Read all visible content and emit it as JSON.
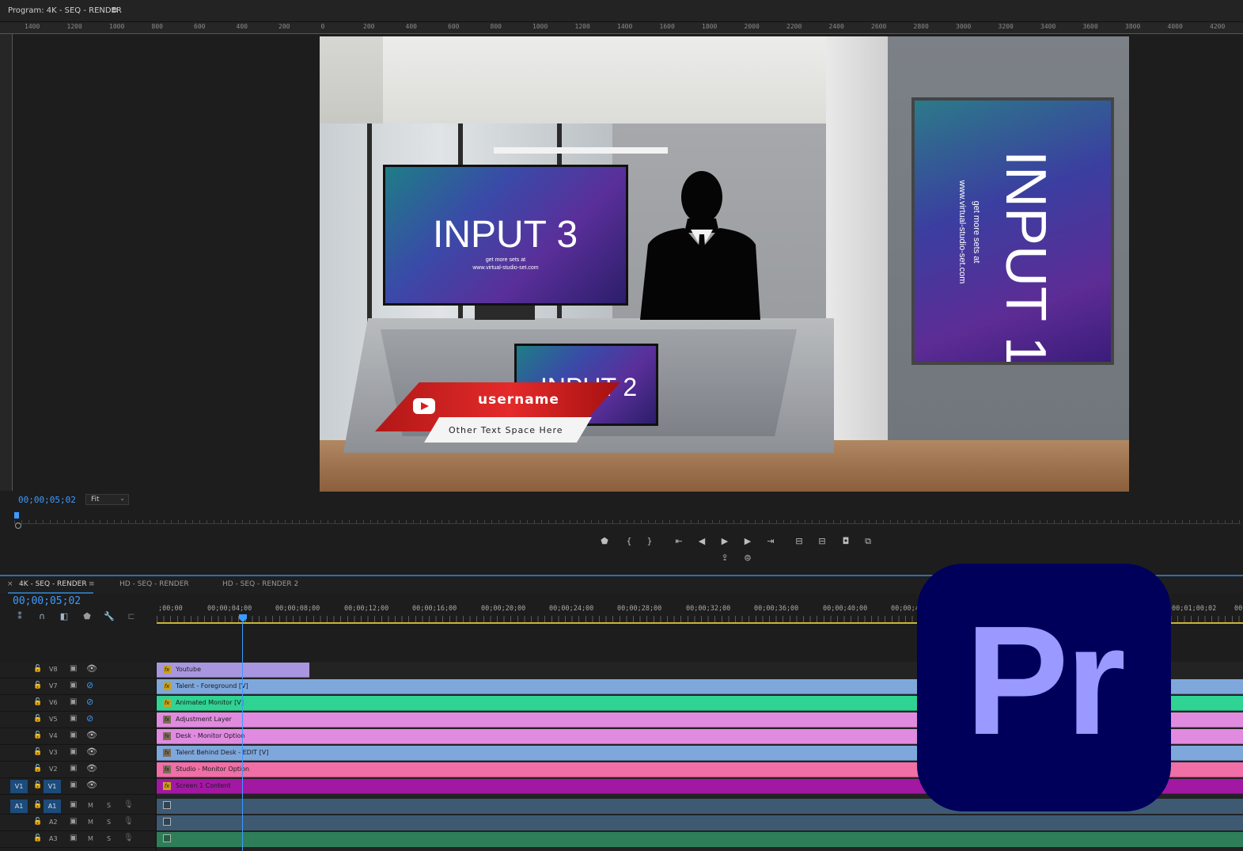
{
  "program_monitor": {
    "title": "Program: 4K - SEQ - RENDER",
    "menu_glyph": "≡",
    "ruler_labels": [
      "1400",
      "1200",
      "1000",
      "800",
      "600",
      "400",
      "200",
      "0",
      "200",
      "400",
      "600",
      "800",
      "1000",
      "1200",
      "1400",
      "1600",
      "1800",
      "2000",
      "2200",
      "2400",
      "2600",
      "2800",
      "3000",
      "3200",
      "3400",
      "3600",
      "3800",
      "4000",
      "4200"
    ],
    "timecode": "00;00;05;02",
    "zoom": "Fit",
    "frame": {
      "monitor_3_label": "INPUT 3",
      "monitor_3_sub_line1": "get more sets at",
      "monitor_3_sub_line2": "www.virtual-studio-set.com",
      "monitor_2_label": "INPUT 2",
      "poster_1_label": "INPUT 1",
      "poster_1_sub_line1": "get more sets at",
      "poster_1_sub_line2": "www.virtual-studio-set.com",
      "lower_third_username": "username",
      "lower_third_text": "Other Text Space Here"
    },
    "controls": [
      {
        "name": "add-marker-button",
        "glyph": "⬟"
      },
      {
        "name": "mark-in-button",
        "glyph": "{"
      },
      {
        "name": "mark-out-button",
        "glyph": "}"
      },
      {
        "name": "go-to-in-button",
        "glyph": "⇤"
      },
      {
        "name": "step-back-button",
        "glyph": "◀"
      },
      {
        "name": "play-button",
        "glyph": "▶"
      },
      {
        "name": "step-forward-button",
        "glyph": "▶"
      },
      {
        "name": "go-to-out-button",
        "glyph": "⇥"
      },
      {
        "name": "lift-button",
        "glyph": "⊟"
      },
      {
        "name": "extract-button",
        "glyph": "⊟"
      },
      {
        "name": "export-frame-button",
        "glyph": "◘"
      },
      {
        "name": "compare-button",
        "glyph": "⧉"
      }
    ],
    "controls_row2": [
      {
        "name": "export-button",
        "glyph": "⇪"
      },
      {
        "name": "vr-button",
        "glyph": "⊜"
      }
    ]
  },
  "timeline": {
    "tabs": [
      {
        "label": "4K - SEQ - RENDER",
        "active": true
      },
      {
        "label": "HD - SEQ - RENDER",
        "active": false
      },
      {
        "label": "HD - SEQ - RENDER 2",
        "active": false
      }
    ],
    "tab_close_glyph": "×",
    "tab_menu_glyph": "≡",
    "timecode": "00;00;05;02",
    "ruler_labels": [
      ";00;00",
      "00;00;04;00",
      "00;00;08;00",
      "00;00;12;00",
      "00;00;16;00",
      "00;00;20;00",
      "00;00;24;00",
      "00;00;28;00",
      "00;00;32;00",
      "00;00;36;00",
      "00;00;40;00",
      "00;00;44",
      "00;01;00;02",
      "00"
    ],
    "tools": [
      "⁑",
      "∩",
      "◧",
      "⬟",
      "🔧",
      "⊏"
    ],
    "video_tracks": [
      {
        "name": "V8",
        "eye_visible": true
      },
      {
        "name": "V7",
        "eye_visible": false
      },
      {
        "name": "V6",
        "eye_visible": false
      },
      {
        "name": "V5",
        "eye_visible": false
      },
      {
        "name": "V4",
        "eye_visible": true
      },
      {
        "name": "V3",
        "eye_visible": true
      },
      {
        "name": "V2",
        "eye_visible": true
      },
      {
        "name": "V1",
        "eye_visible": true,
        "source_target": "V1"
      }
    ],
    "audio_tracks": [
      {
        "name": "A1",
        "source_target": "A1"
      },
      {
        "name": "A2"
      },
      {
        "name": "A3"
      }
    ],
    "track_glyphs": {
      "lock": "🔓",
      "film": "▣",
      "eye": "👁",
      "eye_off": "⊘",
      "mute": "M",
      "solo": "S",
      "mic": "🎙"
    },
    "clips": [
      {
        "track": "V8",
        "label": "Youtube",
        "color": "#a897e0",
        "full": false
      },
      {
        "track": "V7",
        "label": "Talent - Foreground [V]",
        "color": "#7ea7dc",
        "full": true
      },
      {
        "track": "V6",
        "label": "Animated Monitor [V]",
        "color": "#2fd393",
        "full": true
      },
      {
        "track": "V5",
        "label": "Adjustment Layer",
        "color": "#e08be0",
        "full": true
      },
      {
        "track": "V4",
        "label": "Desk - Monitor Option",
        "color": "#e08be0",
        "full": true
      },
      {
        "track": "V3",
        "label": "Talent Behind Desk - EDIT [V]",
        "color": "#7ea7dc",
        "full": true
      },
      {
        "track": "V2",
        "label": "Studio - Monitor Option",
        "color": "#ef6fa6",
        "full": true
      },
      {
        "track": "V1",
        "label": "Screen 1 Content",
        "color": "#a318a3",
        "full": true
      }
    ],
    "audio_colors": [
      "#3e5a73",
      "#3e5a73",
      "#2f7e5a"
    ]
  },
  "logo": {
    "text": "Pr",
    "bg": "#00005b",
    "fg": "#9999ff"
  }
}
